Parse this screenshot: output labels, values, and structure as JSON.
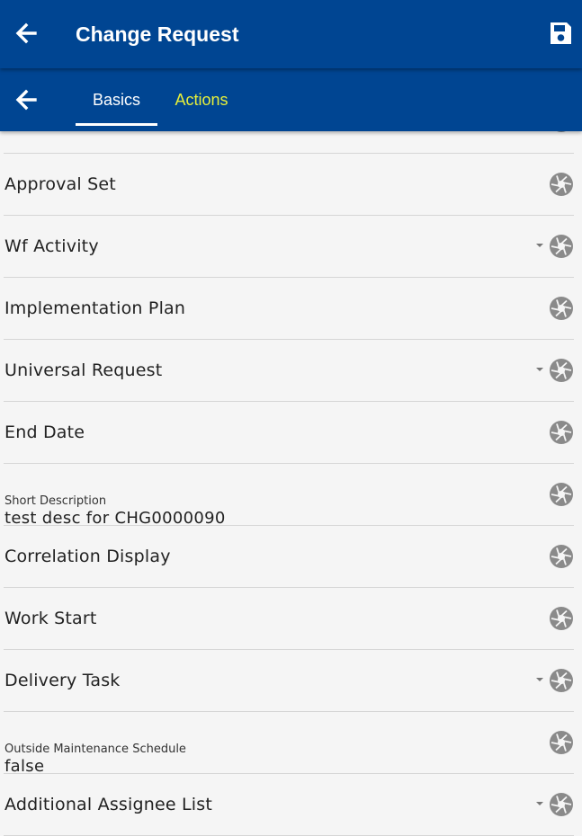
{
  "header": {
    "title": "Change Request"
  },
  "tabs": [
    {
      "label": "Basics",
      "active": true
    },
    {
      "label": "Actions",
      "active": false
    }
  ],
  "colors": {
    "primary": "#004592",
    "active_tab_text": "#ffffff",
    "inactive_tab_text": "#e6ef3a",
    "background": "#f5f5f5"
  },
  "fields": [
    {
      "label": "",
      "partial": true,
      "has_dropdown": false
    },
    {
      "label": "Approval Set",
      "has_dropdown": false
    },
    {
      "label": "Wf Activity",
      "has_dropdown": true
    },
    {
      "label": "Implementation Plan",
      "has_dropdown": false
    },
    {
      "label": "Universal Request",
      "has_dropdown": true
    },
    {
      "label": "End Date",
      "has_dropdown": false
    },
    {
      "label": "Short Description",
      "value": "test desc for CHG0000090",
      "has_dropdown": false
    },
    {
      "label": "Correlation Display",
      "has_dropdown": false
    },
    {
      "label": "Work Start",
      "has_dropdown": false
    },
    {
      "label": "Delivery Task",
      "has_dropdown": true
    },
    {
      "label": "Outside Maintenance Schedule",
      "value": "false",
      "has_dropdown": false
    },
    {
      "label": "Additional Assignee List",
      "has_dropdown": true
    }
  ]
}
